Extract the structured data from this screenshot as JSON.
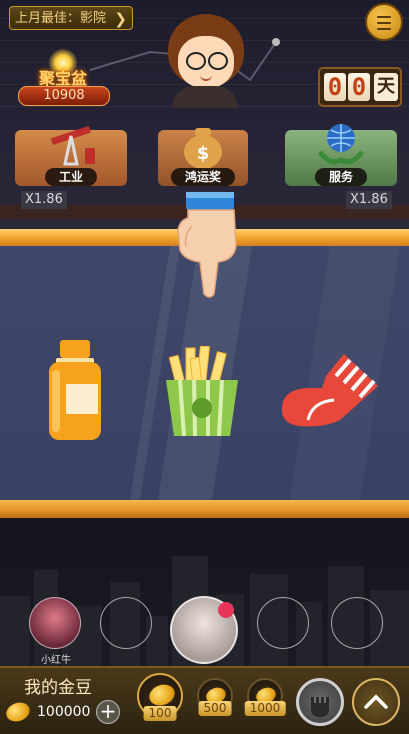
{
  "header": {
    "best_last_month_label": "上月最佳：影院",
    "best_chevron": "❯",
    "treasure_title": "聚宝盆",
    "treasure_value": "10908",
    "days_digits": [
      "0",
      "0"
    ],
    "days_unit": "天"
  },
  "industries": [
    {
      "label": "工业",
      "icon": "oil-pump-icon",
      "multiplier": "X1.86"
    },
    {
      "label": "鸿运奖",
      "icon": "money-bag-icon",
      "multiplier": ""
    },
    {
      "label": "服务",
      "icon": "globe-hand-icon",
      "multiplier": "X1.86"
    }
  ],
  "reels": {
    "items": [
      "bottle-icon",
      "fries-icon",
      "sock-icon"
    ]
  },
  "seats": [
    {
      "name": "小红牛",
      "occupied": true
    },
    {
      "name": "",
      "occupied": false
    },
    {
      "name": "",
      "occupied": true
    },
    {
      "name": "",
      "occupied": false
    },
    {
      "name": "",
      "occupied": false
    }
  ],
  "wallet": {
    "title": "我的金豆",
    "balance": "100000",
    "plus": "+"
  },
  "bets": [
    {
      "label": "100",
      "selected": true
    },
    {
      "label": "500",
      "selected": false
    },
    {
      "label": "1000",
      "selected": false
    }
  ],
  "colors": {
    "gold_rail": "#f2a62c",
    "glass_panel": "#3f4768",
    "bar_bg": "#3a2c14"
  }
}
